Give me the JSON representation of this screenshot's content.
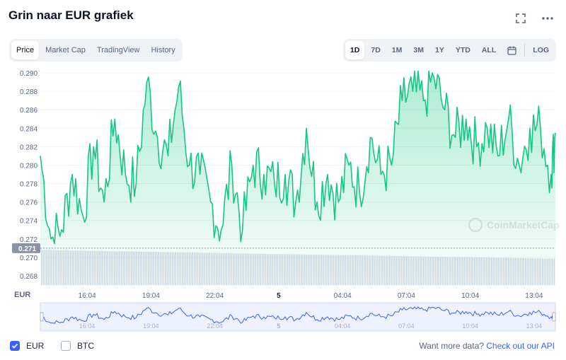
{
  "header": {
    "title": "Grin naar EUR grafiek",
    "expand_icon": "expand-icon",
    "more_icon": "more-dots-icon"
  },
  "tabs": [
    {
      "label": "Price",
      "active": true
    },
    {
      "label": "Market Cap",
      "active": false
    },
    {
      "label": "TradingView",
      "active": false
    },
    {
      "label": "History",
      "active": false
    }
  ],
  "ranges": [
    {
      "label": "1D",
      "active": true
    },
    {
      "label": "7D",
      "active": false
    },
    {
      "label": "1M",
      "active": false
    },
    {
      "label": "3M",
      "active": false
    },
    {
      "label": "1Y",
      "active": false
    },
    {
      "label": "YTD",
      "active": false
    },
    {
      "label": "ALL",
      "active": false
    }
  ],
  "calendar_icon": "calendar-icon",
  "log_label": "LOG",
  "footer": {
    "eur_label": "EUR",
    "eur_checked": true,
    "btc_label": "BTC",
    "btc_checked": false,
    "more_text": "Want more data?",
    "api_link": "Check out our API"
  },
  "colors": {
    "line": "#16c784",
    "area_top": "#16c784",
    "volume": "#cfd6e4",
    "nav_line": "#3861fb",
    "accent": "#3861fb"
  },
  "chart_data": {
    "type": "area",
    "currency_label": "EUR",
    "watermark": "CoinMarketCap",
    "current_price_label": "0.271",
    "current_price": 0.271,
    "ylim": [
      0.267,
      0.291
    ],
    "y_ticks": [
      "0.268",
      "0.270",
      "0.272",
      "0.274",
      "0.276",
      "0.278",
      "0.280",
      "0.282",
      "0.284",
      "0.286",
      "0.288",
      "0.290"
    ],
    "x_ticks": [
      {
        "label": "16:04",
        "t": 2.2
      },
      {
        "label": "19:04",
        "t": 5.2
      },
      {
        "label": "22:04",
        "t": 8.2
      },
      {
        "label": "5",
        "t": 11.2,
        "bold": true
      },
      {
        "label": "04:04",
        "t": 14.2
      },
      {
        "label": "07:04",
        "t": 17.2
      },
      {
        "label": "10:04",
        "t": 20.2
      },
      {
        "label": "13:04",
        "t": 23.2
      }
    ],
    "t_range": [
      0,
      24.2
    ],
    "x": [
      0,
      0.5,
      1,
      1.5,
      2,
      2.5,
      3,
      3.5,
      4,
      4.5,
      5,
      5.5,
      6,
      6.5,
      7,
      7.5,
      8,
      8.5,
      9,
      9.5,
      10,
      10.5,
      11,
      11.5,
      12,
      12.5,
      13,
      13.5,
      14,
      14.5,
      15,
      15.5,
      16,
      16.5,
      17,
      17.5,
      18,
      18.5,
      19,
      19.5,
      20,
      20.5,
      21,
      21.5,
      22,
      22.5,
      23,
      23.5,
      24,
      24.2
    ],
    "values": [
      0.281,
      0.272,
      0.273,
      0.279,
      0.2745,
      0.282,
      0.276,
      0.285,
      0.279,
      0.278,
      0.289,
      0.283,
      0.281,
      0.2885,
      0.28,
      0.279,
      0.276,
      0.273,
      0.28,
      0.273,
      0.28,
      0.279,
      0.278,
      0.279,
      0.276,
      0.284,
      0.276,
      0.279,
      0.276,
      0.28,
      0.277,
      0.283,
      0.279,
      0.28,
      0.287,
      0.288,
      0.287,
      0.2895,
      0.286,
      0.283,
      0.285,
      0.282,
      0.284,
      0.281,
      0.285,
      0.28,
      0.284,
      0.284,
      0.279,
      0.2835
    ]
  }
}
